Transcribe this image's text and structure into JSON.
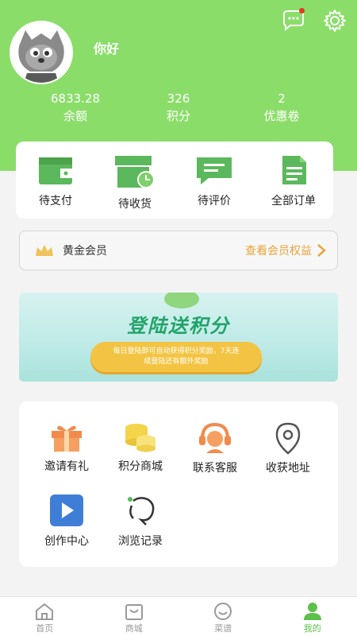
{
  "user": {
    "name": "你好"
  },
  "stats": [
    {
      "value": "6833.28",
      "label": "余额"
    },
    {
      "value": "326",
      "label": "积分"
    },
    {
      "value": "2",
      "label": "优惠卷"
    }
  ],
  "orders": [
    {
      "label": "待支付",
      "icon": "wallet-icon"
    },
    {
      "label": "待收货",
      "icon": "package-clock-icon"
    },
    {
      "label": "待评价",
      "icon": "comment-icon"
    },
    {
      "label": "全部订单",
      "icon": "document-icon"
    }
  ],
  "vip": {
    "title": "黄金会员",
    "link": "查看会员权益"
  },
  "banner": {
    "title": "登陆送积分",
    "line1": "每日登陆即可自动获得积分奖励，7天连",
    "line2": "续登陆还有额外奖励"
  },
  "services": [
    {
      "label": "邀请有礼",
      "icon": "gift-icon"
    },
    {
      "label": "积分商城",
      "icon": "coins-icon"
    },
    {
      "label": "联系客服",
      "icon": "headset-icon"
    },
    {
      "label": "收获地址",
      "icon": "location-pin-icon"
    },
    {
      "label": "创作中心",
      "icon": "video-play-icon"
    },
    {
      "label": "浏览记录",
      "icon": "history-icon"
    }
  ],
  "tabbar": [
    {
      "label": "首页",
      "icon": "home-icon",
      "active": false
    },
    {
      "label": "商城",
      "icon": "shopping-bag-icon",
      "active": false
    },
    {
      "label": "菜谱",
      "icon": "smile-icon",
      "active": false
    },
    {
      "label": "我的",
      "icon": "user-icon",
      "active": true
    }
  ],
  "colors": {
    "brand": "#8bdd6a",
    "icon_green": "#5cb85c",
    "vip_link": "#e9a53b",
    "banner_button": "#f3c443"
  }
}
